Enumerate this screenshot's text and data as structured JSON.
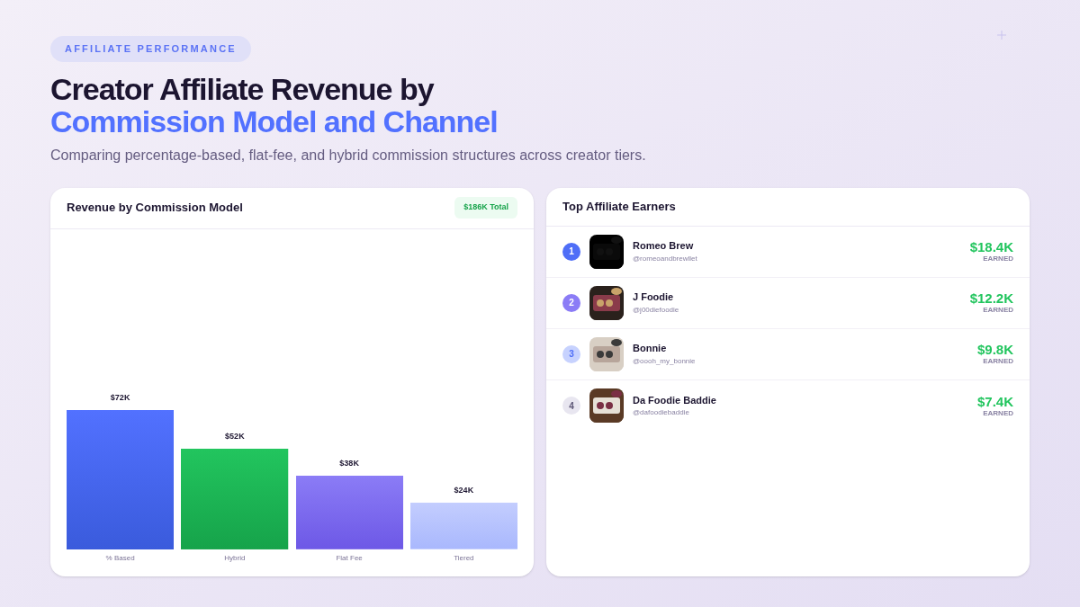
{
  "eyebrow": "AFFILIATE PERFORMANCE",
  "title": {
    "line1": "Creator Affiliate Revenue by",
    "line2": "Commission Model and Channel"
  },
  "subtitle": "Comparing percentage-based, flat-fee, and hybrid commission structures across creator tiers.",
  "revenue_card": {
    "title": "Revenue by Commission Model",
    "badge": "$186K Total",
    "chart_data": {
      "type": "bar",
      "categories": [
        "% Based",
        "Hybrid",
        "Flat Fee",
        "Tiered"
      ],
      "values": [
        72,
        52,
        38,
        24
      ],
      "data_labels": true,
      "value_labels": [
        "$72K",
        "$52K",
        "$38K",
        "$24K"
      ]
    }
  },
  "earners_card": {
    "title": "Top Affiliate Earners",
    "rows": [
      {
        "rank": "1",
        "name": "Romeo Brew",
        "handle": "@romeoandbrewllet",
        "amount": "$18.4K",
        "caption": "EARNED"
      },
      {
        "rank": "2",
        "name": "J Foodie",
        "handle": "@j00diefoodie",
        "amount": "$12.2K",
        "caption": "EARNED"
      },
      {
        "rank": "3",
        "name": "Bonnie",
        "handle": "@oooh_my_bonnie",
        "amount": "$9.8K",
        "caption": "EARNED"
      },
      {
        "rank": "4",
        "name": "Da Foodie Baddie",
        "handle": "@dafoodiebaddie",
        "amount": "$7.4K",
        "caption": "EARNED"
      }
    ]
  }
}
